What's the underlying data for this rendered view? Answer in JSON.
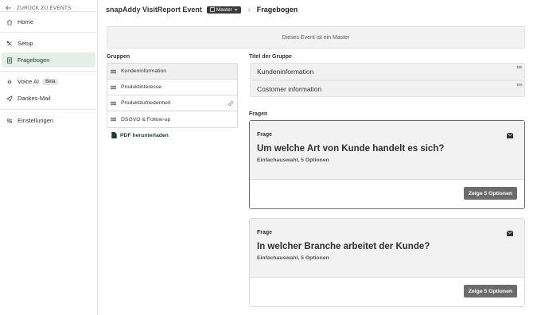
{
  "sidebar": {
    "back_label": "ZURÜCK ZU EVENTS",
    "items": [
      {
        "label": "Home"
      },
      {
        "label": "Setup"
      },
      {
        "label": "Fragebogen"
      },
      {
        "label": "Voice AI",
        "badge": "Beta"
      },
      {
        "label": "Dankes-Mail"
      },
      {
        "label": "Einstellungen"
      }
    ]
  },
  "header": {
    "app_title": "snapAddy VisitReport Event",
    "master_badge": "Master",
    "breadcrumb_sep": "›",
    "page_title": "Fragebogen"
  },
  "banner": {
    "text": "Dieses Event ist ein Master"
  },
  "groups": {
    "label": "Gruppen",
    "items": [
      {
        "label": "Kundeninformation"
      },
      {
        "label": "Produktinteresse"
      },
      {
        "label": "Produktzufriedenheit"
      },
      {
        "label": "DSGVO & Follow-up"
      }
    ],
    "pdf_label": "PDF herunterladen"
  },
  "group_title": {
    "label": "Titel der Gruppe",
    "values": [
      {
        "value": "Kundeninformation",
        "lang": "DE"
      },
      {
        "value": "Costomer information",
        "lang": "EN"
      }
    ]
  },
  "questions": {
    "label": "Fragen",
    "items": [
      {
        "kind": "Frage",
        "text": "Um welche Art von Kunde handelt es sich?",
        "meta": "Einfachauswahl, 5 Optionen",
        "button": "Zeige 5 Optionen"
      },
      {
        "kind": "Frage",
        "text": "In welcher Branche arbeitet der Kunde?",
        "meta": "Einfachauswahl, 5 Optionen",
        "button": "Zeige 5 Optionen"
      }
    ]
  },
  "colors": {
    "active_nav_bg": "#e4efe9",
    "primary_dark": "#1f3b2e",
    "button_bg": "#6b6b6b"
  }
}
